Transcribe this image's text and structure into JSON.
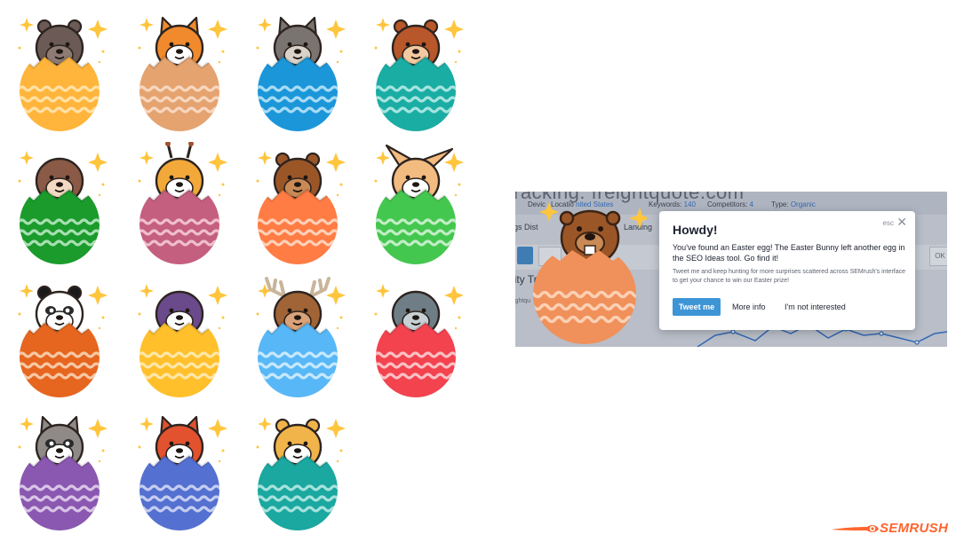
{
  "eggs": [
    {
      "animal": "sea-otter",
      "shell": "#ffb53b",
      "stripe": "#ffe1a6"
    },
    {
      "animal": "corgi",
      "shell": "#e5a370",
      "stripe": "#f8d7bf"
    },
    {
      "animal": "owl",
      "shell": "#1b97d9",
      "stripe": "#a8dcf5"
    },
    {
      "animal": "squirrel",
      "shell": "#1aada4",
      "stripe": "#a6e4df"
    },
    {
      "animal": "sloth",
      "shell": "#1a9b2c",
      "stripe": "#a8dfb1"
    },
    {
      "animal": "giraffe",
      "shell": "#c55f7f",
      "stripe": "#efbfcd"
    },
    {
      "animal": "beaver",
      "shell": "#ff7c44",
      "stripe": "#ffd0b8"
    },
    {
      "animal": "fennec-fox",
      "shell": "#44c74f",
      "stripe": "#c2edc6"
    },
    {
      "animal": "panda",
      "shell": "#e6661f",
      "stripe": "#f8c8a6"
    },
    {
      "animal": "eagle",
      "shell": "#ffc02b",
      "stripe": "#ffe7a8"
    },
    {
      "animal": "moose",
      "shell": "#58b8f7",
      "stripe": "#c8e8fd"
    },
    {
      "animal": "seal",
      "shell": "#f2434f",
      "stripe": "#fbc0c4"
    },
    {
      "animal": "raccoon",
      "shell": "#8a58b0",
      "stripe": "#d8c4e6"
    },
    {
      "animal": "red-panda",
      "shell": "#5470d0",
      "stripe": "#c4cdf0"
    },
    {
      "animal": "hamster",
      "shell": "#1aa8a0",
      "stripe": "#a6e2dd"
    }
  ],
  "screenshot": {
    "title": "racking: freightquote.com",
    "controls": {
      "device": "Devic",
      "location": "Locatio",
      "location_value": "nited States",
      "keywords_label": "Keywords:",
      "keywords_value": "140",
      "competitors_label": "Competitors:",
      "competitors_value": "4",
      "type_label": "Type:",
      "type_value": "Organic"
    },
    "tab1": "gs Dist",
    "tab2": "Landing",
    "ok_label": "OK",
    "section_title": "lity Tre",
    "section_sub": "ightqu",
    "dialog": {
      "esc": "esc",
      "close": "✕",
      "title": "Howdy!",
      "message": "You've found an Easter egg! The Easter Bunny left another egg in the SEO Ideas tool. Go find it!",
      "small": "Tweet me and keep hunting for more surprises scattered across SEMrush's interface to get your chance to win our Easter prize!",
      "tweet_button": "Tweet me",
      "more_info": "More info",
      "not_interested": "I'm not interested"
    },
    "beaver_shell": "#f0905a",
    "beaver_stripe": "#fbd0b4"
  },
  "logo": {
    "text": "SEMRUSH",
    "color": "#ff642d"
  }
}
